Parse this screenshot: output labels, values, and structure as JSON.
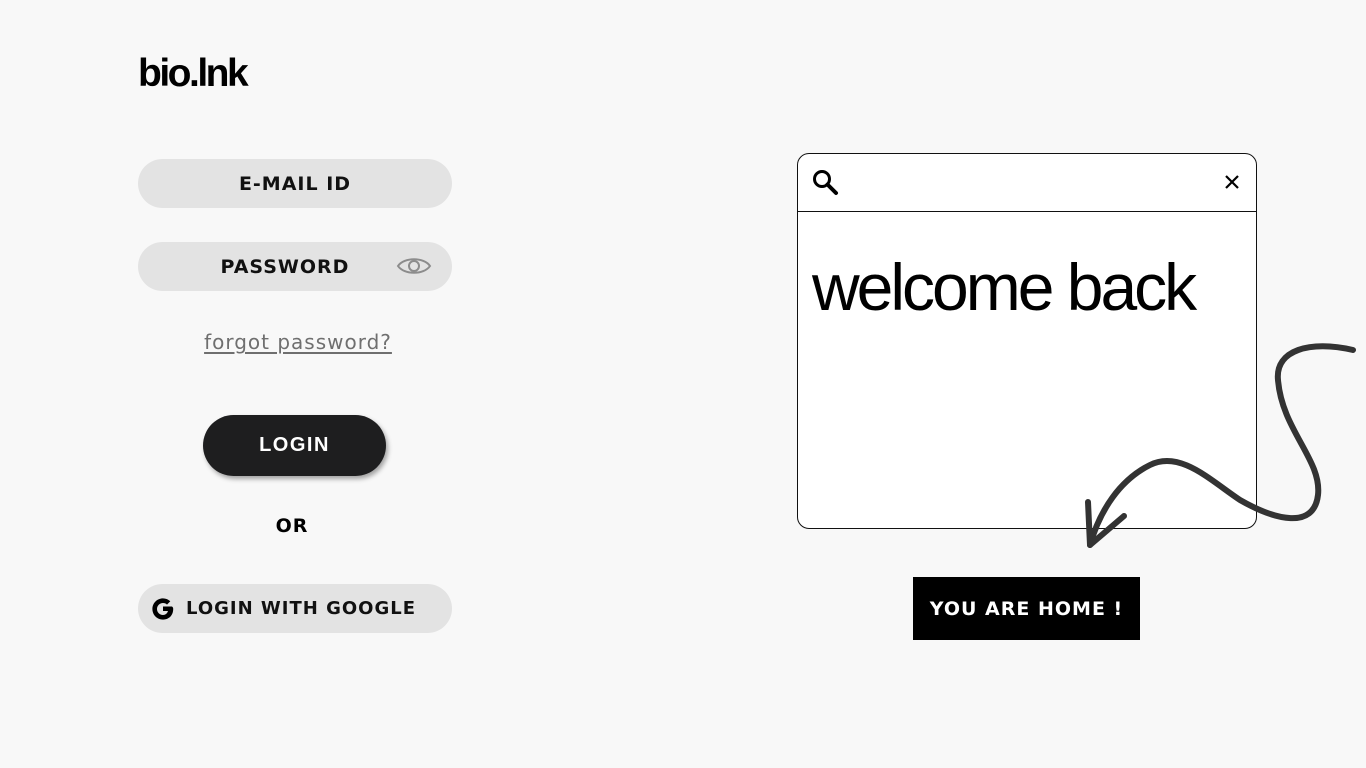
{
  "brand": {
    "logo_text": "bio.lnk"
  },
  "login_form": {
    "email_label": "E-MAIL ID",
    "password_label": "PASSWORD",
    "forgot_password_link": "forgot password?",
    "login_button": "LOGIN",
    "divider_text": "OR",
    "google_button": "LOGIN WITH GOOGLE"
  },
  "icons": {
    "password_toggle": "eye-icon",
    "google": "google-g-icon",
    "search": "search-icon",
    "close": "close-icon"
  },
  "illustration": {
    "search_value": "",
    "headline": "welcome back",
    "badge_text": "YOU ARE HOME !"
  },
  "colors": {
    "background": "#f8f8f8",
    "field_fill": "#e3e3e3",
    "button_dark": "#1e1e1f",
    "link_gray": "#6f6f6f",
    "badge": "#000000"
  }
}
